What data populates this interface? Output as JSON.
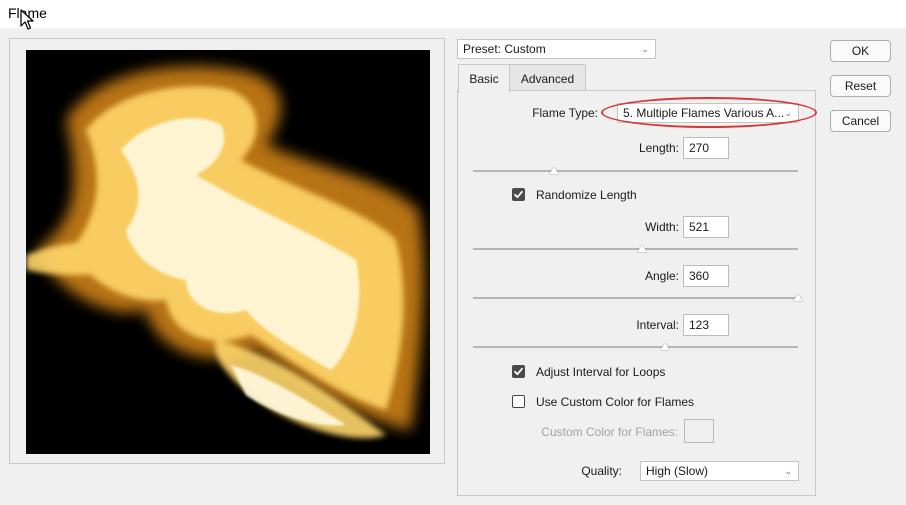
{
  "window": {
    "title": "Flame"
  },
  "preset": {
    "label": "Preset: Custom"
  },
  "tabs": [
    {
      "label": "Basic",
      "active": true
    },
    {
      "label": "Advanced",
      "active": false
    }
  ],
  "basic": {
    "flame_type": {
      "label": "Flame Type:",
      "value": "5. Multiple Flames Various A..."
    },
    "length": {
      "label": "Length:",
      "value": "270",
      "slider_fraction": 0.25
    },
    "randomize_length": {
      "label": "Randomize Length",
      "checked": true
    },
    "width": {
      "label": "Width:",
      "value": "521",
      "slider_fraction": 0.52
    },
    "angle": {
      "label": "Angle:",
      "value": "360",
      "slider_fraction": 1.0
    },
    "interval": {
      "label": "Interval:",
      "value": "123",
      "slider_fraction": 0.59
    },
    "adjust_interval": {
      "label": "Adjust Interval for Loops",
      "checked": true
    },
    "custom_color": {
      "label": "Use Custom Color for Flames",
      "checked": false
    },
    "custom_color_swatch": {
      "label": "Custom Color for Flames:"
    },
    "quality": {
      "label": "Quality:",
      "value": "High (Slow)"
    }
  },
  "buttons": {
    "ok": "OK",
    "reset": "Reset",
    "cancel": "Cancel"
  },
  "colors": {
    "highlight": "#d6383a",
    "flame_core": "#fff8dc",
    "flame_mid": "#ffd66b",
    "flame_edge": "#c27a16"
  }
}
